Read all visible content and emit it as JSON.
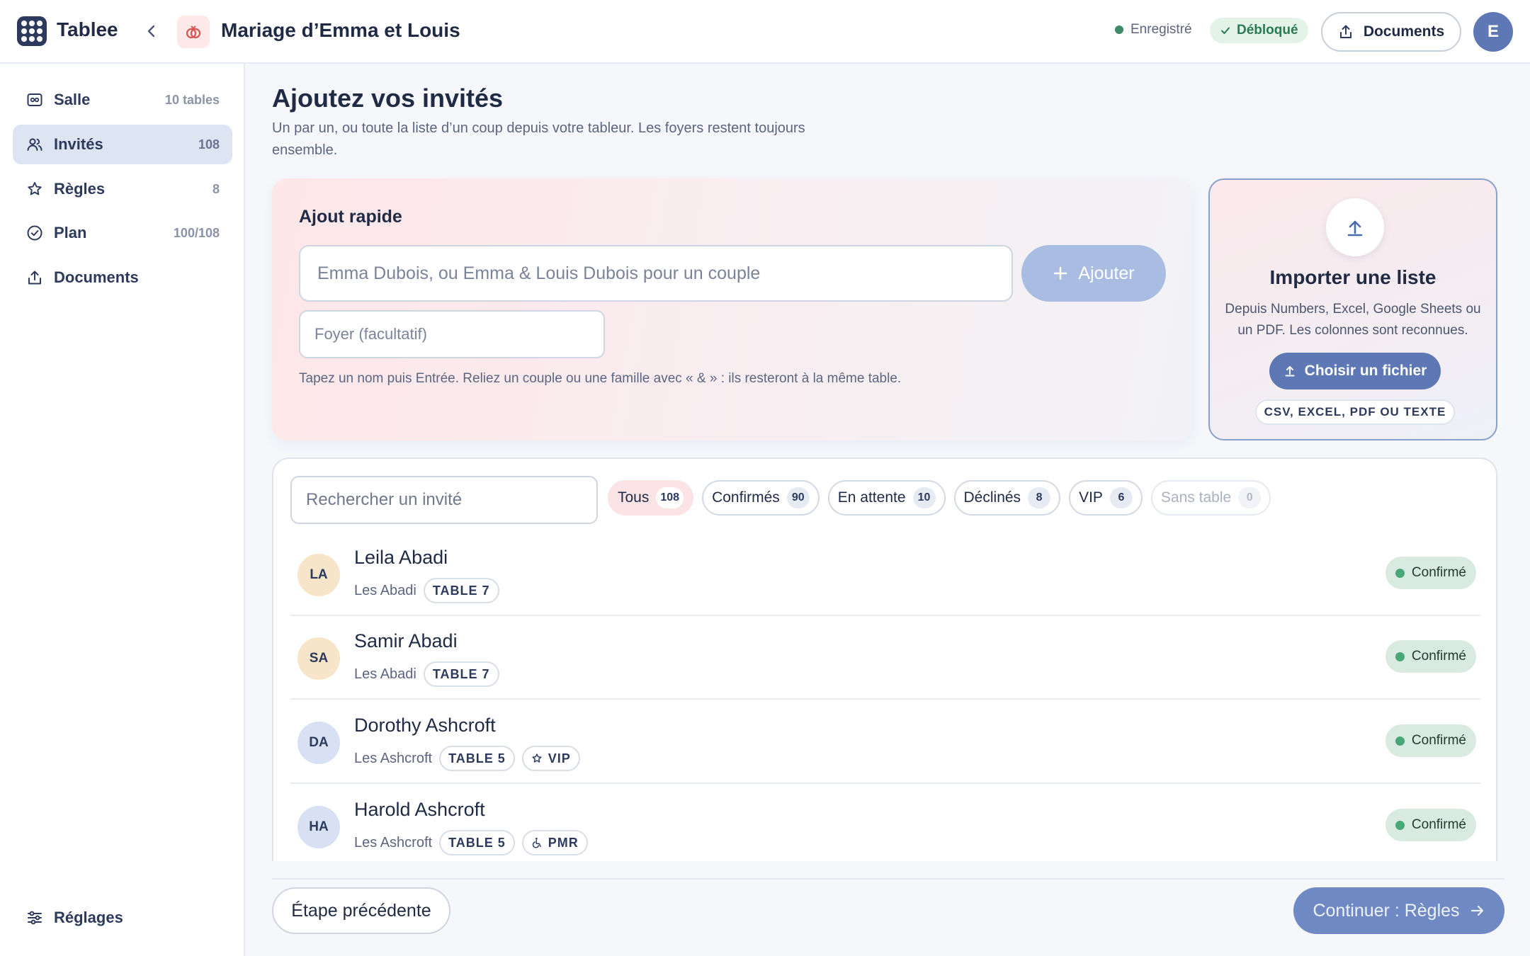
{
  "app": {
    "brand": "Tablee",
    "event_title": "Mariage d’Emma et Louis"
  },
  "header": {
    "saved_label": "Enregistré",
    "unlocked_label": "Débloqué",
    "documents_label": "Documents",
    "avatar_initial": "E"
  },
  "sidebar": {
    "items": [
      {
        "label": "Salle",
        "count": "10 tables",
        "icon": "room-icon"
      },
      {
        "label": "Invités",
        "count": "108",
        "icon": "users-icon",
        "active": true
      },
      {
        "label": "Règles",
        "count": "8",
        "icon": "star-icon"
      },
      {
        "label": "Plan",
        "count": "100/108",
        "icon": "check-circle-icon"
      },
      {
        "label": "Documents",
        "count": "",
        "icon": "upload-icon"
      }
    ],
    "settings_label": "Réglages"
  },
  "page": {
    "title": "Ajoutez vos invités",
    "subtitle": "Un par un, ou toute la liste d’un coup depuis votre tableur. Les foyers restent toujours ensemble."
  },
  "quick_add": {
    "title": "Ajout rapide",
    "name_placeholder": "Emma Dubois, ou Emma & Louis Dubois pour un couple",
    "name_value": "",
    "add_label": "Ajouter",
    "foyer_placeholder": "Foyer (facultatif)",
    "foyer_value": "",
    "hint": "Tapez un nom puis Entrée. Reliez un couple ou une famille avec « & » : ils resteront à la même table."
  },
  "import": {
    "title": "Importer une liste",
    "description": "Depuis Numbers, Excel, Google Sheets ou un PDF. Les colonnes sont reconnues.",
    "choose_label": "Choisir un fichier",
    "formats": "CSV, EXCEL, PDF OU TEXTE"
  },
  "guests": {
    "search_placeholder": "Rechercher un invité",
    "filters": [
      {
        "label": "Tous",
        "count": "108",
        "state": "active"
      },
      {
        "label": "Confirmés",
        "count": "90",
        "state": "normal"
      },
      {
        "label": "En attente",
        "count": "10",
        "state": "normal"
      },
      {
        "label": "Déclinés",
        "count": "8",
        "state": "normal"
      },
      {
        "label": "VIP",
        "count": "6",
        "state": "normal"
      },
      {
        "label": "Sans table",
        "count": "0",
        "state": "muted"
      }
    ],
    "rows": [
      {
        "initials": "LA",
        "name": "Leila Abadi",
        "household": "Les Abadi",
        "table": "TABLE 7",
        "badge": "",
        "status": "Confirmé",
        "avatar_color": "#f6e5c8"
      },
      {
        "initials": "SA",
        "name": "Samir Abadi",
        "household": "Les Abadi",
        "table": "TABLE 7",
        "badge": "",
        "status": "Confirmé",
        "avatar_color": "#f6e5c8"
      },
      {
        "initials": "DA",
        "name": "Dorothy Ashcroft",
        "household": "Les Ashcroft",
        "table": "TABLE 5",
        "badge": "VIP",
        "badge_icon": "star-icon",
        "status": "Confirmé",
        "avatar_color": "#d8e1f3"
      },
      {
        "initials": "HA",
        "name": "Harold Ashcroft",
        "household": "Les Ashcroft",
        "table": "TABLE 5",
        "badge": "PMR",
        "badge_icon": "wheelchair-icon",
        "status": "Confirmé",
        "avatar_color": "#d8e1f3"
      }
    ]
  },
  "footer": {
    "prev_label": "Étape précédente",
    "next_label": "Continuer : Règles"
  },
  "colors": {
    "accent": "#5d78b4",
    "accent_light": "#a9bde3",
    "confirm": "#48a878",
    "chip_active": "#fce3e5"
  }
}
